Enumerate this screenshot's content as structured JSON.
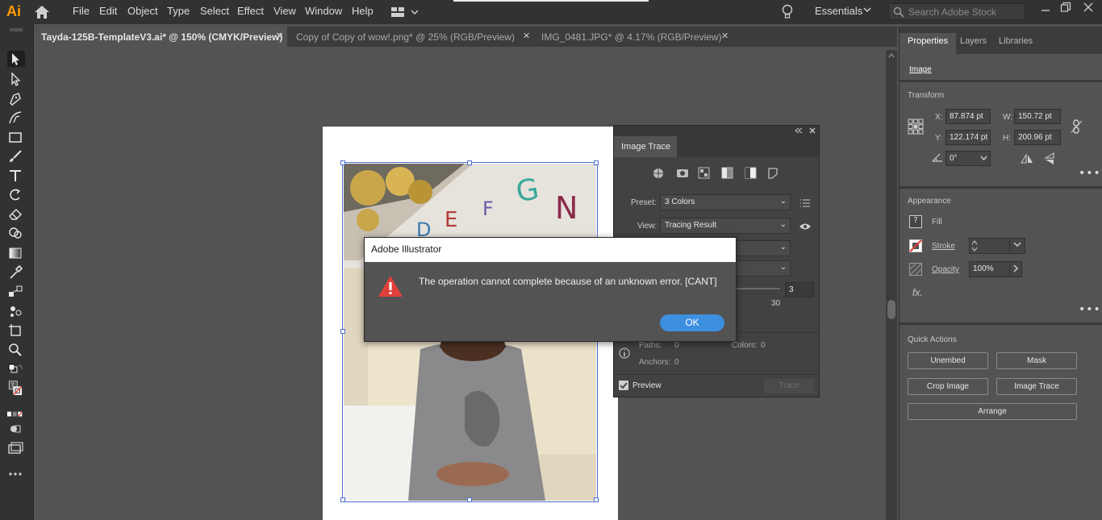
{
  "app": {
    "logo": "Ai",
    "menu": [
      "File",
      "Edit",
      "Object",
      "Type",
      "Select",
      "Effect",
      "View",
      "Window",
      "Help"
    ],
    "workspace": "Essentials",
    "search_placeholder": "Search Adobe Stock"
  },
  "tabs": [
    {
      "label": "Tayda-125B-TemplateV3.ai* @ 150% (CMYK/Preview)",
      "active": true
    },
    {
      "label": "Copy of Copy of wow!.png* @ 25% (RGB/Preview)",
      "active": false
    },
    {
      "label": "IMG_0481.JPG* @ 4.17% (RGB/Preview)",
      "active": false
    }
  ],
  "tools": [
    "selection-tool",
    "direct-selection-tool",
    "pen-tool",
    "curvature-tool",
    "rectangle-tool",
    "paintbrush-tool",
    "type-tool",
    "rotate-tool",
    "eraser-tool",
    "shape-builder-tool",
    "gradient-tool",
    "eyedropper-tool",
    "blend-tool",
    "symbol-sprayer-tool",
    "artboard-tool",
    "zoom-tool"
  ],
  "image_trace": {
    "title": "Image Trace",
    "preset_label": "Preset:",
    "preset_value": "3 Colors",
    "view_label": "View:",
    "view_value": "Tracing Result",
    "threshold_value": "3",
    "slider_max": "30",
    "paths_label": "Paths:",
    "paths_value": "0",
    "colors_label": "Colors:",
    "colors_value": "0",
    "anchors_label": "Anchors:",
    "anchors_value": "0",
    "preview_label": "Preview",
    "trace_button": "Trace"
  },
  "properties": {
    "tabs": [
      "Properties",
      "Layers",
      "Libraries"
    ],
    "object_type": "Image",
    "transform_title": "Transform",
    "x_label": "X:",
    "x_value": "87.874 pt",
    "y_label": "Y:",
    "y_value": "122.174 pt",
    "w_label": "W:",
    "w_value": "150.72 pt",
    "h_label": "H:",
    "h_value": "200.96 pt",
    "angle_value": "0°",
    "appearance_title": "Appearance",
    "fill_label": "Fill",
    "stroke_label": "Stroke",
    "opacity_label": "Opacity",
    "opacity_value": "100%",
    "fx_label": "fx.",
    "quick_actions_title": "Quick Actions",
    "qa_unembed": "Unembed",
    "qa_mask": "Mask",
    "qa_crop": "Crop Image",
    "qa_trace": "Image Trace",
    "qa_arrange": "Arrange"
  },
  "dialog": {
    "title": "Adobe Illustrator",
    "message": "The operation cannot complete because of an unknown error.   [CANT]",
    "ok": "OK"
  },
  "colors": {
    "accent": "#3d8fe0",
    "warning": "#e0403a",
    "logo": "#ff9a00"
  }
}
